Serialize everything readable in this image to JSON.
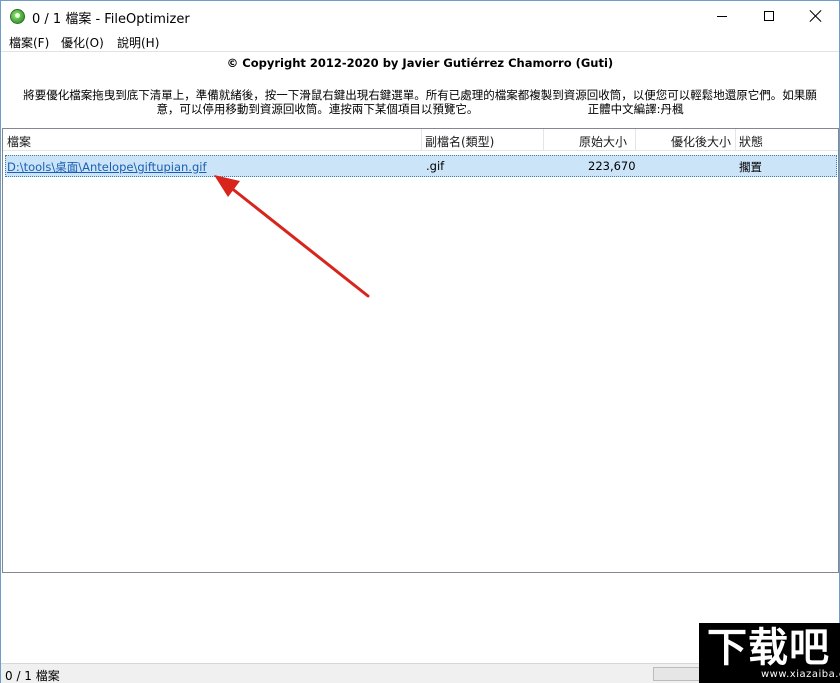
{
  "window": {
    "title": "0 / 1 檔案 - FileOptimizer",
    "icon": "fileoptimizer-app-icon"
  },
  "menu": {
    "items": [
      {
        "label": "檔案(F)"
      },
      {
        "label": "優化(O)"
      },
      {
        "label": "說明(H)"
      }
    ]
  },
  "info": {
    "copyright": "© Copyright 2012-2020 by Javier Gutiérrez Chamorro (Guti)",
    "line1": "將要優化檔案拖曳到底下清單上，準備就緒後，按一下滑鼠右鍵出現右鍵選單。所有已處理的檔案都複製到資源回收筒，以便您可以輕鬆地還原它們。如果願",
    "line2": "意，可以停用移動到資源回收筒。連按兩下某個項目以預覽它。　　　　　　　　　　正體中文編譯:丹楓"
  },
  "list": {
    "columns": [
      "檔案",
      "副檔名(類型)",
      "原始大小",
      "優化後大小",
      "狀態"
    ],
    "rows": [
      {
        "file": "D:\\tools\\桌面\\Antelope\\giftupian.gif",
        "ext": ".gif",
        "original_size": "223,670",
        "optimized_size": "",
        "status": "擱置"
      }
    ]
  },
  "statusbar": {
    "text": "0 / 1 檔案",
    "progress": 0
  },
  "watermark": {
    "main": "下载吧",
    "sub": "www.xiazaiba.com"
  },
  "colors": {
    "selection": "#cce4f7",
    "link": "#1a5fb4",
    "arrow": "#d9241c"
  }
}
